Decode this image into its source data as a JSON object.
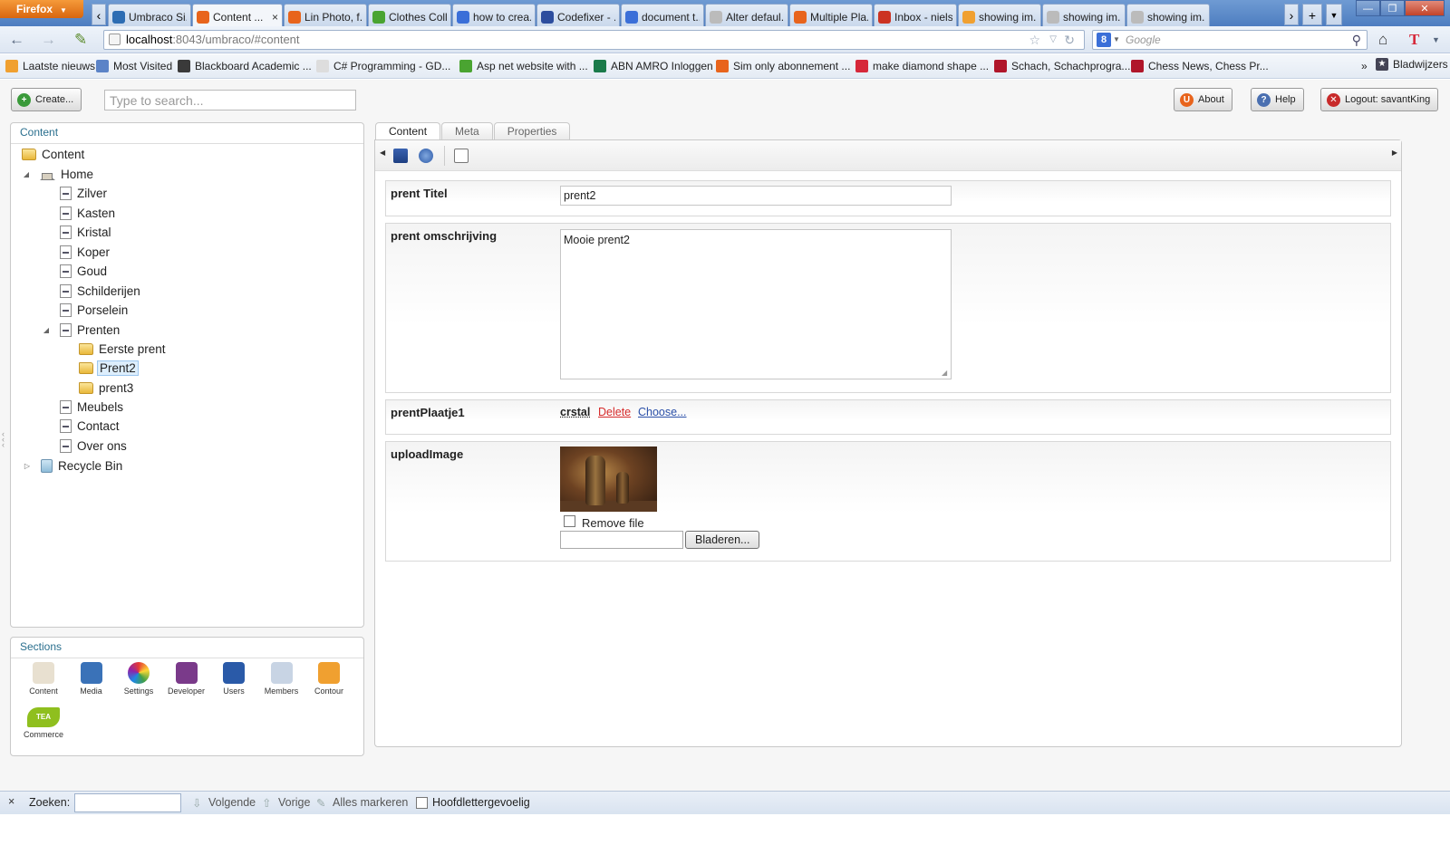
{
  "browser": {
    "menu_label": "Firefox",
    "tabs": [
      {
        "title": "Umbraco Si...",
        "color": "#2d6db3"
      },
      {
        "title": "Content ...",
        "color": "#e8641c",
        "active": true
      },
      {
        "title": "Lin Photo, f...",
        "color": "#e8641c"
      },
      {
        "title": "Clothes Coll...",
        "color": "#4aa431"
      },
      {
        "title": "how to crea...",
        "color": "#3b6fd8"
      },
      {
        "title": "Codefixer - ...",
        "color": "#2d4d9e"
      },
      {
        "title": "document t...",
        "color": "#3b6fd8"
      },
      {
        "title": "Alter defaul...",
        "color": "#bbbbbb"
      },
      {
        "title": "Multiple Pla...",
        "color": "#e8641c"
      },
      {
        "title": "Inbox - niels...",
        "color": "#cc3322"
      },
      {
        "title": "showing im...",
        "color": "#f0a030"
      },
      {
        "title": "showing im...",
        "color": "#bbbbbb"
      },
      {
        "title": "showing im...",
        "color": "#bbbbbb"
      }
    ],
    "tab_close": "×",
    "url_host": "localhost",
    "url_path": ":8043/umbraco/#content",
    "search_engine": "Google",
    "search_engine_badge": "8",
    "bookmarks": [
      {
        "label": "Laatste nieuws",
        "color": "#f0a030"
      },
      {
        "label": "Most Visited",
        "color": "#5b83c7"
      },
      {
        "label": "Blackboard Academic ...",
        "color": "#3a3a3a"
      },
      {
        "label": "C# Programming - GD...",
        "color": "#dddddd"
      },
      {
        "label": "Asp net website with ...",
        "color": "#4aa431"
      },
      {
        "label": "ABN AMRO Inloggen",
        "color": "#1a7a4a"
      },
      {
        "label": "Sim only abonnement ...",
        "color": "#e8641c"
      },
      {
        "label": "make diamond shape ...",
        "color": "#d6283a"
      },
      {
        "label": "Schach, Schachprogra...",
        "color": "#b0162a"
      },
      {
        "label": "Chess News, Chess Pr...",
        "color": "#b0162a"
      }
    ],
    "bookmarks_overflow": "»",
    "bookmarks_menu": "Bladwijzers"
  },
  "header": {
    "create_label": "Create...",
    "search_placeholder": "Type to search...",
    "about_label": "About",
    "help_label": "Help",
    "logout_label": "Logout: savantKing",
    "help_badge": "?",
    "logout_badge": "✕"
  },
  "content_tree": {
    "title": "Content",
    "root": "Content",
    "home": "Home",
    "home_children": [
      "Zilver",
      "Kasten",
      "Kristal",
      "Koper",
      "Goud",
      "Schilderijen",
      "Porselein",
      "Prenten"
    ],
    "prenten_children": [
      "Eerste prent",
      "Prent2",
      "prent3"
    ],
    "after_prenten": [
      "Meubels",
      "Contact",
      "Over ons"
    ],
    "recycle_bin": "Recycle Bin",
    "selected": "Prent2"
  },
  "sections": {
    "title": "Sections",
    "items": [
      {
        "label": "Content",
        "color": "#e8e0d0"
      },
      {
        "label": "Media",
        "color": "#3a72b8"
      },
      {
        "label": "Settings",
        "color": "#f4b030"
      },
      {
        "label": "Developer",
        "color": "#7a3a8a"
      },
      {
        "label": "Users",
        "color": "#2a5aa8"
      },
      {
        "label": "Members",
        "color": "#c8d4e4"
      },
      {
        "label": "Contour",
        "color": "#f0a030"
      },
      {
        "label": "Commerce",
        "color": "#8fbf1e"
      }
    ],
    "commerce_badge": "TEA"
  },
  "editor": {
    "tabs": [
      "Content",
      "Meta",
      "Properties"
    ],
    "properties": {
      "title_label": "prent Titel",
      "title_value": "prent2",
      "description_label": "prent omschrijving",
      "description_value": "Mooie prent2",
      "picture_label": "prentPlaatje1",
      "picture_value": "crstal",
      "picture_delete": "Delete",
      "picture_choose": "Choose...",
      "upload_label": "uploadImage",
      "remove_file_label": "Remove file",
      "browse_label": "Bladeren..."
    }
  },
  "findbar": {
    "close": "×",
    "find_label": "Zoeken:",
    "next_label": "Volgende",
    "prev_label": "Vorige",
    "highlight_label": "Alles markeren",
    "match_case_label": "Hoofdlettergevoelig"
  }
}
